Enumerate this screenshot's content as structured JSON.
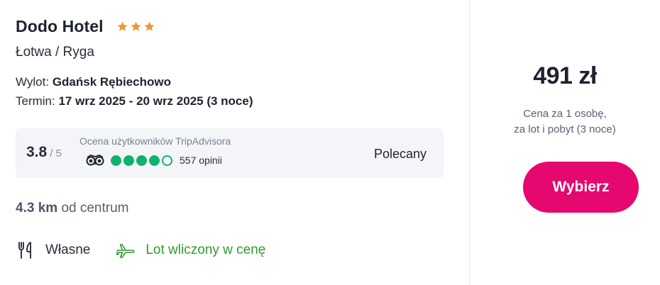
{
  "hotel": {
    "name": "Dodo Hotel",
    "stars": 3,
    "location": "Łotwa / Ryga"
  },
  "flight": {
    "departure_label": "Wylot:",
    "departure_airport": "Gdańsk Rębiechowo",
    "term_label": "Termin:",
    "term_value": "17 wrz 2025 - 20 wrz 2025 (3 noce)"
  },
  "tripadvisor": {
    "score": "3.8",
    "max": "/ 5",
    "label": "Ocena użytkowników TripAdvisora",
    "bubbles_filled": 4,
    "bubbles_total": 5,
    "reviews": "557 opinii",
    "verdict": "Polecany"
  },
  "distance": {
    "value": "4.3 km",
    "suffix": "od centrum"
  },
  "features": {
    "meals": "Własne",
    "flight": "Lot wliczony w cenę"
  },
  "pricing": {
    "price": "491 zł",
    "note_line1": "Cena za 1 osobę,",
    "note_line2": "za lot i pobyt (3 noce)",
    "button_label": "Wybierz"
  },
  "colors": {
    "accent": "#e5086f",
    "star": "#f7932f",
    "tripadvisor_green": "#10b26a",
    "flight_green": "#2e9c2e"
  },
  "icons": {
    "star": "star-icon",
    "tripadvisor": "tripadvisor-owl-icon",
    "meals": "fork-knife-icon",
    "flight": "airplane-icon"
  }
}
